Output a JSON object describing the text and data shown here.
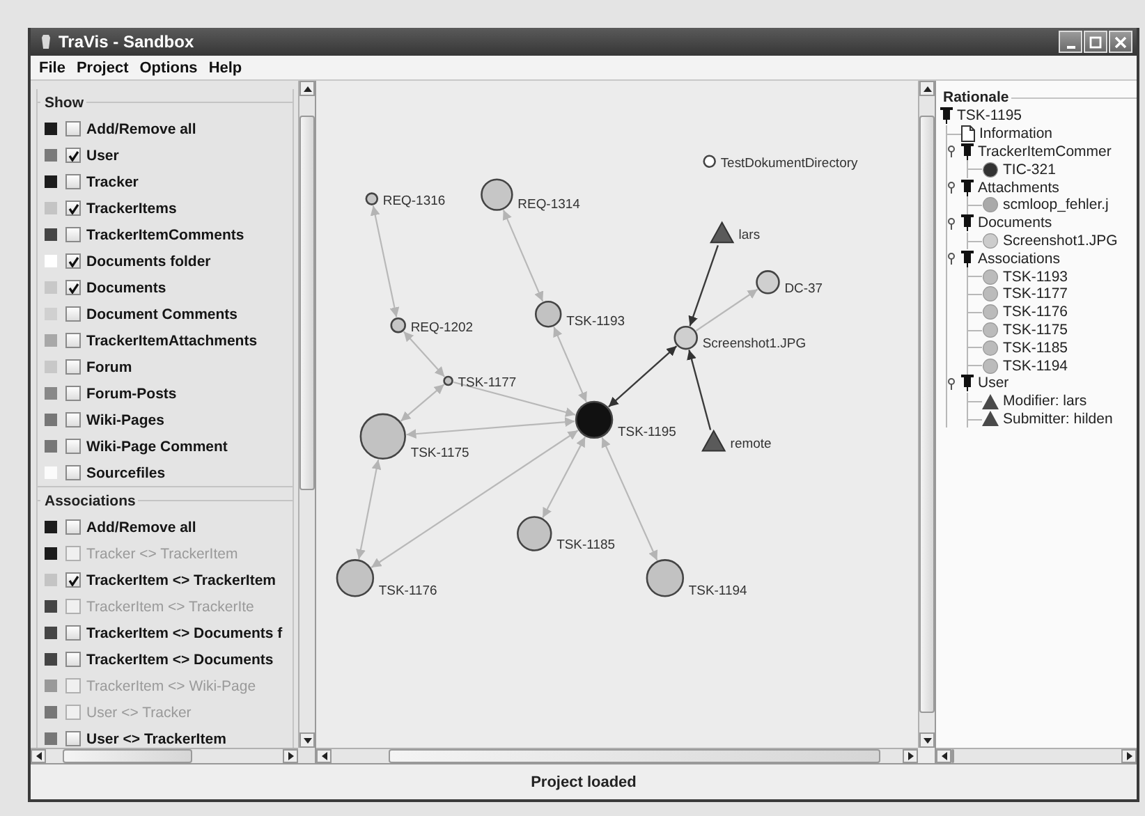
{
  "window": {
    "title": "TraVis - Sandbox"
  },
  "menu": [
    "File",
    "Project",
    "Options",
    "Help"
  ],
  "show_panel": {
    "sections": [
      {
        "title": "Show",
        "items": [
          {
            "label": "Add/Remove all",
            "color": "#1c1c1c",
            "checked": false,
            "disabled": false
          },
          {
            "label": "User",
            "color": "#7a7a7a",
            "checked": true,
            "disabled": false
          },
          {
            "label": "Tracker",
            "color": "#1c1c1c",
            "checked": false,
            "disabled": false
          },
          {
            "label": "TrackerItems",
            "color": "#c4c4c4",
            "checked": true,
            "disabled": false
          },
          {
            "label": "TrackerItemComments",
            "color": "#454545",
            "checked": false,
            "disabled": false
          },
          {
            "label": "Documents folder",
            "color": "#ffffff",
            "checked": true,
            "disabled": false
          },
          {
            "label": "Documents",
            "color": "#c8c8c8",
            "checked": true,
            "disabled": false
          },
          {
            "label": "Document Comments",
            "color": "#d0d0d0",
            "checked": false,
            "disabled": false
          },
          {
            "label": "TrackerItemAttachments",
            "color": "#a8a8a8",
            "checked": false,
            "disabled": false
          },
          {
            "label": "Forum",
            "color": "#c8c8c8",
            "checked": false,
            "disabled": false
          },
          {
            "label": "Forum-Posts",
            "color": "#888888",
            "checked": false,
            "disabled": false
          },
          {
            "label": "Wiki-Pages",
            "color": "#777777",
            "checked": false,
            "disabled": false
          },
          {
            "label": "Wiki-Page Comment",
            "color": "#777777",
            "checked": false,
            "disabled": false
          },
          {
            "label": "Sourcefiles",
            "color": "#fbfbfb",
            "checked": false,
            "disabled": false
          }
        ]
      },
      {
        "title": "Associations",
        "items": [
          {
            "label": "Add/Remove all",
            "color": "#1c1c1c",
            "checked": false,
            "disabled": false
          },
          {
            "label": "Tracker <> TrackerItem",
            "color": "#1c1c1c",
            "checked": false,
            "disabled": true
          },
          {
            "label": "TrackerItem <> TrackerItem",
            "color": "#c4c4c4",
            "checked": true,
            "disabled": false
          },
          {
            "label": "TrackerItem <> TrackerIte",
            "color": "#454545",
            "checked": false,
            "disabled": true
          },
          {
            "label": "TrackerItem <> Documents f",
            "color": "#454545",
            "checked": false,
            "disabled": false
          },
          {
            "label": "TrackerItem <> Documents",
            "color": "#454545",
            "checked": false,
            "disabled": false
          },
          {
            "label": "TrackerItem <> Wiki-Page",
            "color": "#999999",
            "checked": false,
            "disabled": true
          },
          {
            "label": "User <> Tracker",
            "color": "#777777",
            "checked": false,
            "disabled": true
          },
          {
            "label": "User <> TrackerItem",
            "color": "#777777",
            "checked": false,
            "disabled": false
          }
        ]
      }
    ]
  },
  "graph": {
    "nodes": [
      {
        "label": "TestDokumentDirectory",
        "kind": "folder",
        "selected": false
      },
      {
        "label": "REQ-1316",
        "kind": "requirement",
        "selected": false
      },
      {
        "label": "REQ-1314",
        "kind": "requirement",
        "selected": false
      },
      {
        "label": "lars",
        "kind": "user",
        "selected": false
      },
      {
        "label": "DC-37",
        "kind": "document",
        "selected": false
      },
      {
        "label": "TSK-1193",
        "kind": "task",
        "selected": false
      },
      {
        "label": "REQ-1202",
        "kind": "requirement",
        "selected": false
      },
      {
        "label": "Screenshot1.JPG",
        "kind": "document",
        "selected": false
      },
      {
        "label": "TSK-1177",
        "kind": "task",
        "selected": false
      },
      {
        "label": "TSK-1195",
        "kind": "task",
        "selected": true
      },
      {
        "label": "TSK-1175",
        "kind": "task",
        "selected": false
      },
      {
        "label": "remote",
        "kind": "user",
        "selected": false
      },
      {
        "label": "TSK-1185",
        "kind": "task",
        "selected": false
      },
      {
        "label": "TSK-1176",
        "kind": "task",
        "selected": false
      },
      {
        "label": "TSK-1194",
        "kind": "task",
        "selected": false
      }
    ]
  },
  "rationale": {
    "title": "Rationale",
    "tree": [
      {
        "label": "TSK-1195",
        "kind": "group",
        "children": [
          {
            "label": "Information",
            "kind": "document"
          },
          {
            "label": "TrackerItemCommer",
            "kind": "group",
            "expanded": true,
            "children": [
              {
                "label": "TIC-321",
                "kind": "item",
                "color": "#333333"
              }
            ]
          },
          {
            "label": "Attachments",
            "kind": "group",
            "expanded": true,
            "children": [
              {
                "label": "scmloop_fehler.j",
                "kind": "item",
                "color": "#aaaaaa"
              }
            ]
          },
          {
            "label": "Documents",
            "kind": "group",
            "expanded": true,
            "children": [
              {
                "label": "Screenshot1.JPG",
                "kind": "item",
                "color": "#cccccc"
              }
            ]
          },
          {
            "label": "Associations",
            "kind": "group",
            "expanded": true,
            "children": [
              {
                "label": "TSK-1193",
                "kind": "item",
                "color": "#bbbbbb"
              },
              {
                "label": "TSK-1177",
                "kind": "item",
                "color": "#bbbbbb"
              },
              {
                "label": "TSK-1176",
                "kind": "item",
                "color": "#bbbbbb"
              },
              {
                "label": "TSK-1175",
                "kind": "item",
                "color": "#bbbbbb"
              },
              {
                "label": "TSK-1185",
                "kind": "item",
                "color": "#bbbbbb"
              },
              {
                "label": "TSK-1194",
                "kind": "item",
                "color": "#bbbbbb"
              }
            ]
          },
          {
            "label": "User",
            "kind": "group",
            "expanded": true,
            "children": [
              {
                "label": "Modifier: lars",
                "kind": "user"
              },
              {
                "label": "Submitter: hilden",
                "kind": "user"
              }
            ]
          }
        ]
      }
    ]
  },
  "status_bar": "Project loaded"
}
